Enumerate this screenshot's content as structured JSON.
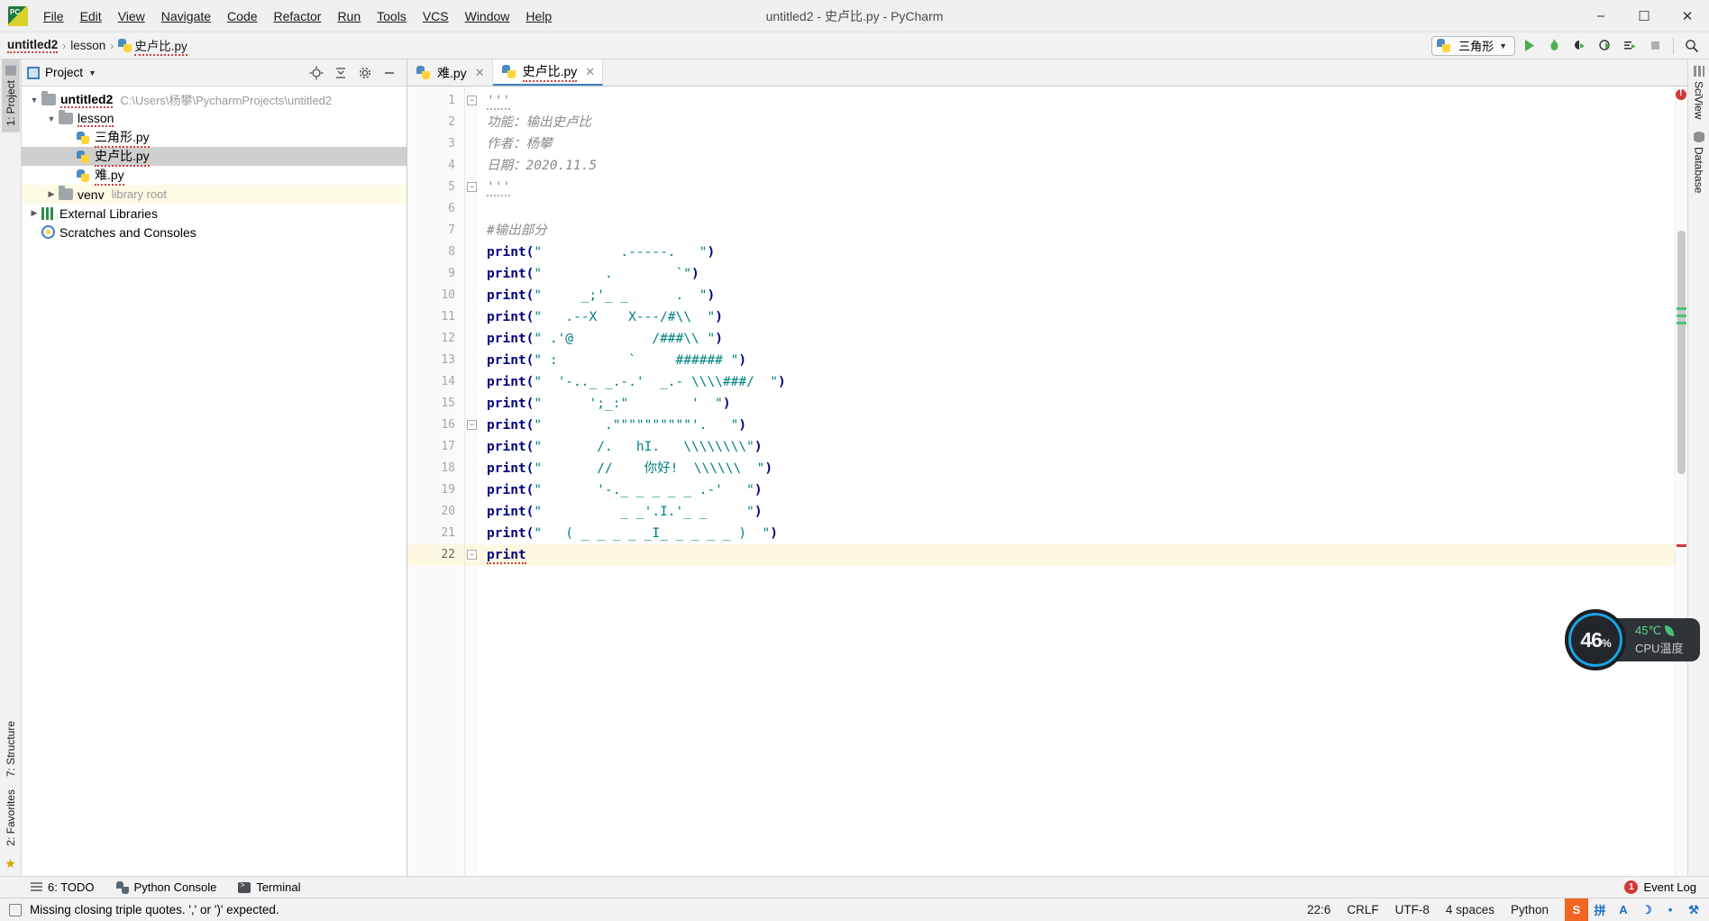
{
  "window": {
    "title": "untitled2 - 史卢比.py - PyCharm",
    "minimize": "–",
    "maximize": "☐",
    "close": "✕"
  },
  "menu": {
    "items": [
      "File",
      "Edit",
      "View",
      "Navigate",
      "Code",
      "Refactor",
      "Run",
      "Tools",
      "VCS",
      "Window",
      "Help"
    ]
  },
  "breadcrumb": {
    "project": "untitled2",
    "folder": "lesson",
    "file": "史卢比.py",
    "separator": "›"
  },
  "toolbar": {
    "run_config": "三角形",
    "caret": "▼",
    "icons": [
      "run-icon",
      "debug-icon",
      "coverage-icon",
      "profile-icon",
      "run-with-console-icon",
      "stop-icon",
      "search-icon"
    ]
  },
  "rails": {
    "left_top": "1: Project",
    "left_bottom_structure": "7: Structure",
    "left_bottom_favorites": "2: Favorites",
    "right_sciview": "SciView",
    "right_database": "Database"
  },
  "project_panel": {
    "title": "Project",
    "caret": "▼",
    "actions": [
      "locate-icon",
      "collapse-all-icon",
      "settings-icon",
      "hide-icon"
    ],
    "tree": [
      {
        "indent": 0,
        "arrow": "▼",
        "icon": "folder",
        "label": "untitled2",
        "bold": true,
        "hint": "C:\\Users\\杨攀\\PycharmProjects\\untitled2",
        "selected": false,
        "highlight": false,
        "squiggle": true
      },
      {
        "indent": 1,
        "arrow": "▼",
        "icon": "folder",
        "label": "lesson",
        "bold": false,
        "hint": "",
        "selected": false,
        "highlight": false,
        "squiggle": true
      },
      {
        "indent": 2,
        "arrow": "",
        "icon": "python",
        "label": "三角形.py",
        "bold": false,
        "hint": "",
        "selected": false,
        "highlight": false,
        "squiggle": true
      },
      {
        "indent": 2,
        "arrow": "",
        "icon": "python",
        "label": "史卢比.py",
        "bold": false,
        "hint": "",
        "selected": true,
        "highlight": false,
        "squiggle": true
      },
      {
        "indent": 2,
        "arrow": "",
        "icon": "python",
        "label": "难.py",
        "bold": false,
        "hint": "",
        "selected": false,
        "highlight": false,
        "squiggle": true
      },
      {
        "indent": 1,
        "arrow": "▶",
        "icon": "folder",
        "label": "venv",
        "bold": false,
        "hint": "library root",
        "selected": false,
        "highlight": true,
        "squiggle": false
      },
      {
        "indent": 0,
        "arrow": "▶",
        "icon": "library",
        "label": "External Libraries",
        "bold": false,
        "hint": "",
        "selected": false,
        "highlight": false,
        "squiggle": false
      },
      {
        "indent": 0,
        "arrow": "",
        "icon": "scratch",
        "label": "Scratches and Consoles",
        "bold": false,
        "hint": "",
        "selected": false,
        "highlight": false,
        "squiggle": false
      }
    ]
  },
  "editor": {
    "tabs": [
      {
        "label": "难.py",
        "active": false,
        "error": false
      },
      {
        "label": "史卢比.py",
        "active": true,
        "error": true
      }
    ],
    "close_glyph": "✕",
    "current_line": 22,
    "lines": [
      {
        "n": 1,
        "fold": "−",
        "segments": [
          {
            "t": "'''",
            "c": "doc wave"
          }
        ]
      },
      {
        "n": 2,
        "fold": "",
        "segments": [
          {
            "t": "功能：输出史卢比",
            "c": "doc"
          }
        ]
      },
      {
        "n": 3,
        "fold": "",
        "segments": [
          {
            "t": "作者：杨攀",
            "c": "doc"
          }
        ]
      },
      {
        "n": 4,
        "fold": "",
        "segments": [
          {
            "t": "日期：2020.11.5",
            "c": "doc"
          }
        ]
      },
      {
        "n": 5,
        "fold": "−",
        "segments": [
          {
            "t": "'''",
            "c": "doc wave"
          }
        ]
      },
      {
        "n": 6,
        "fold": "",
        "segments": []
      },
      {
        "n": 7,
        "fold": "",
        "segments": [
          {
            "t": "#输出部分",
            "c": "cmt"
          }
        ]
      },
      {
        "n": 8,
        "fold": "",
        "segments": [
          {
            "t": "print",
            "c": "kw"
          },
          {
            "t": "(",
            "c": "pnc"
          },
          {
            "t": "\"          .-----.   \"",
            "c": "str"
          },
          {
            "t": ")",
            "c": "pnc"
          }
        ]
      },
      {
        "n": 9,
        "fold": "",
        "segments": [
          {
            "t": "print",
            "c": "kw"
          },
          {
            "t": "(",
            "c": "pnc"
          },
          {
            "t": "\"        .        `\"",
            "c": "str"
          },
          {
            "t": ")",
            "c": "pnc"
          }
        ]
      },
      {
        "n": 10,
        "fold": "",
        "segments": [
          {
            "t": "print",
            "c": "kw"
          },
          {
            "t": "(",
            "c": "pnc"
          },
          {
            "t": "\"     _;'_ _      .  \"",
            "c": "str"
          },
          {
            "t": ")",
            "c": "pnc"
          }
        ]
      },
      {
        "n": 11,
        "fold": "",
        "segments": [
          {
            "t": "print",
            "c": "kw"
          },
          {
            "t": "(",
            "c": "pnc"
          },
          {
            "t": "\"   .--X    X---/#\\\\  \"",
            "c": "str"
          },
          {
            "t": ")",
            "c": "pnc"
          }
        ]
      },
      {
        "n": 12,
        "fold": "",
        "segments": [
          {
            "t": "print",
            "c": "kw"
          },
          {
            "t": "(",
            "c": "pnc"
          },
          {
            "t": "\" .'@          /###\\\\ \"",
            "c": "str"
          },
          {
            "t": ")",
            "c": "pnc"
          }
        ]
      },
      {
        "n": 13,
        "fold": "",
        "segments": [
          {
            "t": "print",
            "c": "kw"
          },
          {
            "t": "(",
            "c": "pnc"
          },
          {
            "t": "\" :         `     ###### \"",
            "c": "str"
          },
          {
            "t": ")",
            "c": "pnc"
          }
        ]
      },
      {
        "n": 14,
        "fold": "",
        "segments": [
          {
            "t": "print",
            "c": "kw"
          },
          {
            "t": "(",
            "c": "pnc"
          },
          {
            "t": "\"  '-.._ _.-.'  _.- \\\\\\\\###/  \"",
            "c": "str"
          },
          {
            "t": ")",
            "c": "pnc"
          }
        ]
      },
      {
        "n": 15,
        "fold": "",
        "segments": [
          {
            "t": "print",
            "c": "kw"
          },
          {
            "t": "(",
            "c": "pnc"
          },
          {
            "t": "\"      ';_:\"        '  \"",
            "c": "str"
          },
          {
            "t": ")",
            "c": "pnc"
          }
        ]
      },
      {
        "n": 16,
        "fold": "−",
        "segments": [
          {
            "t": "print",
            "c": "kw"
          },
          {
            "t": "(",
            "c": "pnc"
          },
          {
            "t": "\"        .\"\"\"\"\"\"\"\"\"\"'.   \"",
            "c": "str"
          },
          {
            "t": ")",
            "c": "pnc"
          }
        ]
      },
      {
        "n": 17,
        "fold": "",
        "segments": [
          {
            "t": "print",
            "c": "kw"
          },
          {
            "t": "(",
            "c": "pnc"
          },
          {
            "t": "\"       /.   hI.   \\\\\\\\\\\\\\\\\"",
            "c": "str"
          },
          {
            "t": ")",
            "c": "pnc"
          }
        ]
      },
      {
        "n": 18,
        "fold": "",
        "segments": [
          {
            "t": "print",
            "c": "kw"
          },
          {
            "t": "(",
            "c": "pnc"
          },
          {
            "t": "\"       //    你好!  \\\\\\\\\\\\  \"",
            "c": "str"
          },
          {
            "t": ")",
            "c": "pnc"
          }
        ]
      },
      {
        "n": 19,
        "fold": "",
        "segments": [
          {
            "t": "print",
            "c": "kw"
          },
          {
            "t": "(",
            "c": "pnc"
          },
          {
            "t": "\"       '-._ _ _ _ _ .-'   \"",
            "c": "str"
          },
          {
            "t": ")",
            "c": "pnc"
          }
        ]
      },
      {
        "n": 20,
        "fold": "",
        "segments": [
          {
            "t": "print",
            "c": "kw"
          },
          {
            "t": "(",
            "c": "pnc"
          },
          {
            "t": "\"          _ _'.I.'_ _     \"",
            "c": "str"
          },
          {
            "t": ")",
            "c": "pnc"
          }
        ]
      },
      {
        "n": 21,
        "fold": "",
        "segments": [
          {
            "t": "print",
            "c": "kw"
          },
          {
            "t": "(",
            "c": "pnc"
          },
          {
            "t": "\"   ( _ _ _ _ _I_ _ _ _ _ )  \"",
            "c": "str"
          },
          {
            "t": ")",
            "c": "pnc"
          }
        ]
      },
      {
        "n": 22,
        "fold": "−",
        "segments": [
          {
            "t": "print",
            "c": "kw redwave"
          }
        ]
      }
    ]
  },
  "cpu_widget": {
    "percent": "46",
    "percent_unit": "%",
    "temperature": "45℃",
    "label": "CPU温度"
  },
  "bottom_bar": {
    "todo": "6: TODO",
    "python_console": "Python Console",
    "terminal": "Terminal",
    "event_log": "Event Log",
    "event_count": "1"
  },
  "status_bar": {
    "message": "Missing closing triple quotes. ',' or ')' expected.",
    "caret": "22:6",
    "line_sep": "CRLF",
    "encoding": "UTF-8",
    "indent": "4 spaces",
    "interpreter": "Python",
    "ime": [
      "S",
      "拼",
      "A",
      "☽",
      "•",
      "⚒"
    ]
  },
  "colors": {
    "accent": "#3f7fbf",
    "string": "#008080",
    "keyword": "#000080",
    "comment": "#8a8a8a",
    "error": "#d03a3a",
    "selection": "#cfcfcf",
    "current_line": "#fdf8e2"
  }
}
